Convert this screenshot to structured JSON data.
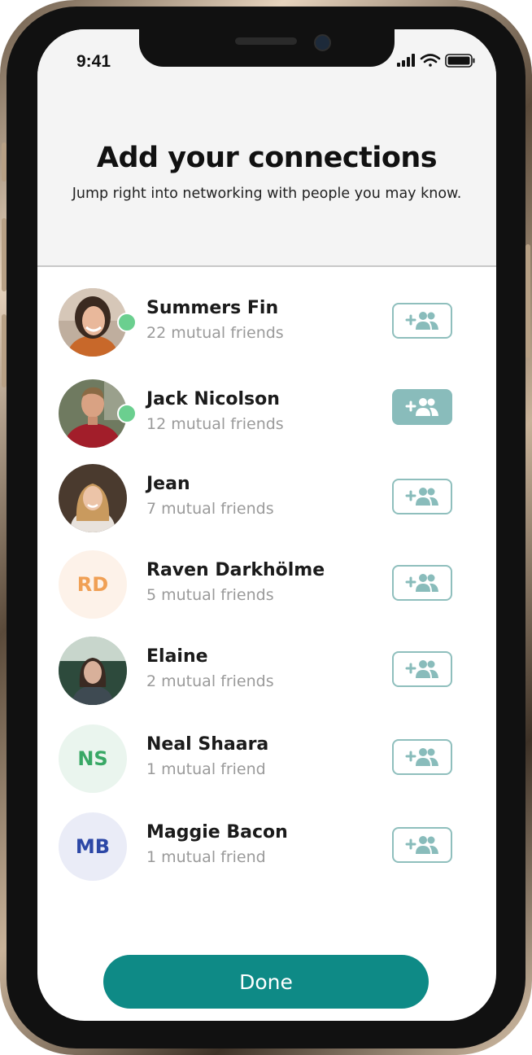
{
  "status_bar": {
    "time": "9:41"
  },
  "header": {
    "title": "Add your connections",
    "subtitle": "Jump right into networking with people you may know."
  },
  "contacts": [
    {
      "name": "Summers Fin",
      "mutual": "22 mutual friends",
      "avatar": "photo",
      "online": true,
      "added": false
    },
    {
      "name": "Jack Nicolson",
      "mutual": "12 mutual friends",
      "avatar": "photo",
      "online": true,
      "added": true
    },
    {
      "name": "Jean",
      "mutual": "7 mutual friends",
      "avatar": "photo",
      "online": false,
      "added": false
    },
    {
      "name": "Raven Darkhölme",
      "mutual": "5 mutual friends",
      "initials": "RD",
      "initials_color": "#f0a055",
      "initials_bg": "#fdf2e9",
      "online": false,
      "added": false
    },
    {
      "name": "Elaine",
      "mutual": "2 mutual friends",
      "avatar": "photo",
      "online": false,
      "added": false
    },
    {
      "name": "Neal Shaara",
      "mutual": "1 mutual friend",
      "initials": "NS",
      "initials_color": "#38a865",
      "initials_bg": "#eaf5ee",
      "online": false,
      "added": false
    },
    {
      "name": "Maggie Bacon",
      "mutual": "1 mutual friend",
      "initials": "MB",
      "initials_color": "#2c47a6",
      "initials_bg": "#eaecf7",
      "online": false,
      "added": false
    }
  ],
  "icons": {
    "add_friend": "add-friend-icon"
  },
  "colors": {
    "accent": "#0e8a86",
    "button_border": "#8fbfbd",
    "button_active": "#89bcbb",
    "online": "#6bcf8f"
  },
  "footer": {
    "done_label": "Done"
  }
}
